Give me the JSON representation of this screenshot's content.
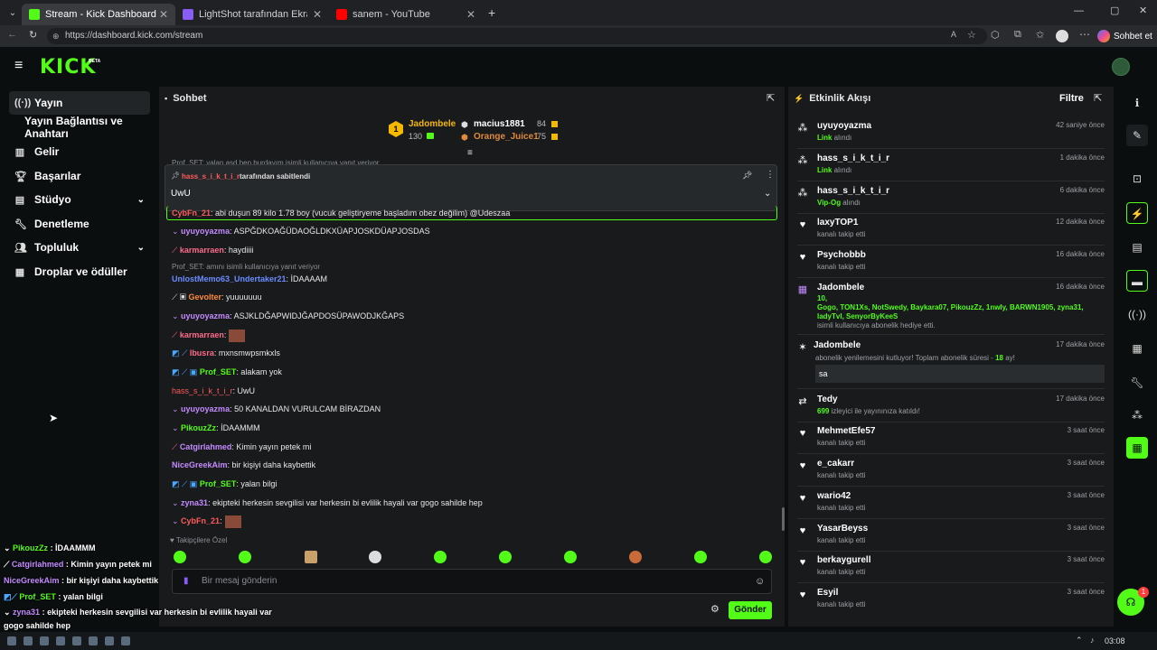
{
  "browser": {
    "tabs": [
      {
        "title": "Stream - Kick Dashboard",
        "color": "#53fc18"
      },
      {
        "title": "LightShot tarafından Ekran Görüntü",
        "color": "#8a5cf6"
      },
      {
        "title": "sanem - YouTube",
        "color": "#ff0000"
      }
    ],
    "url": "https://dashboard.kick.com/stream",
    "profile_label": "Sohbet et"
  },
  "app": {
    "logo": "KICK",
    "logo_tag": "BETA"
  },
  "sidebar": {
    "items": [
      {
        "label": "Yayın",
        "icon": "broadcast-icon",
        "active": true
      },
      {
        "label": "Yayın Bağlantısı ve Anahtarı",
        "icon": "",
        "sub": true
      },
      {
        "label": "Gelir",
        "icon": "chart-icon"
      },
      {
        "label": "Başarılar",
        "icon": "trophy-icon"
      },
      {
        "label": "Stüdyo",
        "icon": "studio-icon",
        "chevron": true
      },
      {
        "label": "Denetleme",
        "icon": "wrench-icon"
      },
      {
        "label": "Topluluk",
        "icon": "community-icon",
        "chevron": true
      },
      {
        "label": "Droplar ve ödüller",
        "icon": "gift-icon"
      }
    ]
  },
  "chat": {
    "title": "Sohbet",
    "leaderboard": [
      {
        "rank": "1",
        "name": "Jadombele",
        "value": "130"
      },
      {
        "name": "macius1881",
        "value": "84"
      },
      {
        "name": "Orange_Juice1",
        "value": "75"
      }
    ],
    "pinned": {
      "user": "hass_s_i_k_t_i_r",
      "by": "tarafından sabitlendi",
      "text": "UwU"
    },
    "top_reply": "Prof_SET: yalan asd hep burdayım isimli kullanıcıya yanıt veriyor",
    "messages": [
      {
        "user": "CybFn_21",
        "text": ": abi duşun 89 kilo 1.78 boy (vucuk geliştiryeme başladım obez değilim) @Udeszaa",
        "color": "#ff5a5a"
      },
      {
        "user": "uyuyoyazma",
        "text": ": ASPĞDKOAĞÜDAOĞLDKXÜAPJOSKDÜAPJOSDAS",
        "color": "#c48bff"
      },
      {
        "user": "karmarraen",
        "text": ": haydiiii",
        "color": "#ff6b8a"
      },
      {
        "reply": "Prof_SET: amını isimli kullanıcıya yanıt veriyor"
      },
      {
        "user": "UnlostMemo63_Undertaker21",
        "text": ": İDAAAAM",
        "color": "#6b8cff"
      },
      {
        "user": "Gevolter",
        "text": ": yuuuuuuu",
        "color": "#ff8a3a"
      },
      {
        "user": "uyuyoyazma",
        "text": ": ASJKLDĞAPWIDJĞAPDOSÜPAWODJKĞAPS",
        "color": "#c48bff"
      },
      {
        "user": "karmarraen",
        "text": ":",
        "color": "#ff6b8a"
      },
      {
        "user": "Ibusra",
        "text": ": mxnsmwpsmkxls",
        "color": "#ff6b8a"
      },
      {
        "user": "Prof_SET",
        "text": ": alakam yok",
        "color": "#53fc18"
      },
      {
        "user": "hass_s_i_k_t_i_r",
        "text": ": UwU",
        "color": "#ff5a5a"
      },
      {
        "user": "uyuyoyazma",
        "text": ": 50 KANALDAN VURULCAM BİRAZDAN",
        "color": "#c48bff"
      },
      {
        "user": "PikouzZz",
        "text": ": İDAAMMM",
        "color": "#53fc18"
      },
      {
        "user": "Catgirlahmed",
        "text": ": Kimin yayın petek mi",
        "color": "#c48bff"
      },
      {
        "user": "NiceGreekAim",
        "text": ": bir kişiyi daha kaybettik",
        "color": "#c48bff"
      },
      {
        "user": "Prof_SET",
        "text": ": yalan bilgi",
        "color": "#53fc18"
      },
      {
        "user": "zyna31",
        "text": ": ekipteki herkesin sevgilisi var herkesin bi evlilik hayali var gogo sahilde hep",
        "color": "#c48bff"
      },
      {
        "user": "CybFn_21",
        "text": ":",
        "color": "#ff5a5a"
      }
    ],
    "followers_only": "Takipçilere Özel",
    "input_placeholder": "Bir mesaj gönderin",
    "send_label": "Gönder"
  },
  "activity": {
    "title": "Etkinlik Akışı",
    "filter": "Filtre",
    "items": [
      {
        "name": "uyuyoyazma",
        "time": "42 saniye önce",
        "hl": "Link",
        "sub": " alındı",
        "icon": "drops-icon"
      },
      {
        "name": "hass_s_i_k_t_i_r",
        "time": "1 dakika önce",
        "hl": "Link",
        "sub": " alındı",
        "icon": "drops-icon"
      },
      {
        "name": "hass_s_i_k_t_i_r",
        "time": "6 dakika önce",
        "hl": "Vip-Og",
        "sub": " alındı",
        "icon": "drops-icon"
      },
      {
        "name": "laxyTOP1",
        "time": "12 dakika önce",
        "hl": "",
        "sub": "kanalı takip etti",
        "icon": "heart-icon"
      },
      {
        "name": "Psychobbb",
        "time": "16 dakika önce",
        "hl": "",
        "sub": "kanalı takip etti",
        "icon": "heart-icon"
      },
      {
        "name": "Jadombele",
        "time": "16 dakika önce",
        "hl": "10,",
        "gift_list": "Gogo, TON1Xs, NotSwedy, Baykara07, PikouzZz, 1nwly, BARWN1905, zyna31, ladyTvl, SenyorByKeeS",
        "sub": "isimli kullanıcıya abonelik hediye etti.",
        "icon": "gift-icon"
      },
      {
        "name": "Jadombele",
        "time": "17 dakika önce",
        "sub_pre": "abonelik yenilemesini kutluyor! Toplam abonelik süresi - ",
        "hl": "18",
        "sub": " ay!",
        "note": "sa",
        "icon": "star-icon"
      },
      {
        "name": "Tedy",
        "time": "17 dakika önce",
        "hl": "699",
        "sub": " izleyici ile yayınınıza katıldı!",
        "icon": "raid-icon"
      },
      {
        "name": "MehmetEfe57",
        "time": "3 saat önce",
        "hl": "",
        "sub": "kanalı takip etti",
        "icon": "heart-icon"
      },
      {
        "name": "e_cakarr",
        "time": "3 saat önce",
        "hl": "",
        "sub": "kanalı takip etti",
        "icon": "heart-icon"
      },
      {
        "name": "wario42",
        "time": "3 saat önce",
        "hl": "",
        "sub": "kanalı takip etti",
        "icon": "heart-icon"
      },
      {
        "name": "YasarBeyss",
        "time": "3 saat önce",
        "hl": "",
        "sub": "kanalı takip etti",
        "icon": "heart-icon"
      },
      {
        "name": "berkaygurell",
        "time": "3 saat önce",
        "hl": "",
        "sub": "kanalı takip etti",
        "icon": "heart-icon"
      },
      {
        "name": "Esyil",
        "time": "3 saat önce",
        "hl": "",
        "sub": "kanalı takip etti",
        "icon": "heart-icon"
      }
    ]
  },
  "overlay": [
    {
      "user": "PikouzZz",
      "text": " : İDAAMMM",
      "color": "#53fc18"
    },
    {
      "user": "Catgirlahmed",
      "text": " : Kimin yayın petek mi",
      "color": "#c48bff"
    },
    {
      "user": "NiceGreekAim",
      "text": " : bir kişiyi daha kaybettik",
      "color": "#c48bff"
    },
    {
      "user": "Prof_SET",
      "text": " : yalan bilgi",
      "color": "#53fc18"
    },
    {
      "user": "zyna31",
      "text": " : ekipteki herkesin sevgilisi var herkesin bi evlilik hayali var",
      "color": "#c48bff"
    },
    {
      "user": "",
      "text": "gogo sahilde hep",
      "color": "#fff"
    }
  ],
  "notification_count": "1",
  "clock": "03:08",
  "colors": {
    "accent": "#53fc18",
    "panel": "#181a1c",
    "bg": "#0b0e0f"
  }
}
